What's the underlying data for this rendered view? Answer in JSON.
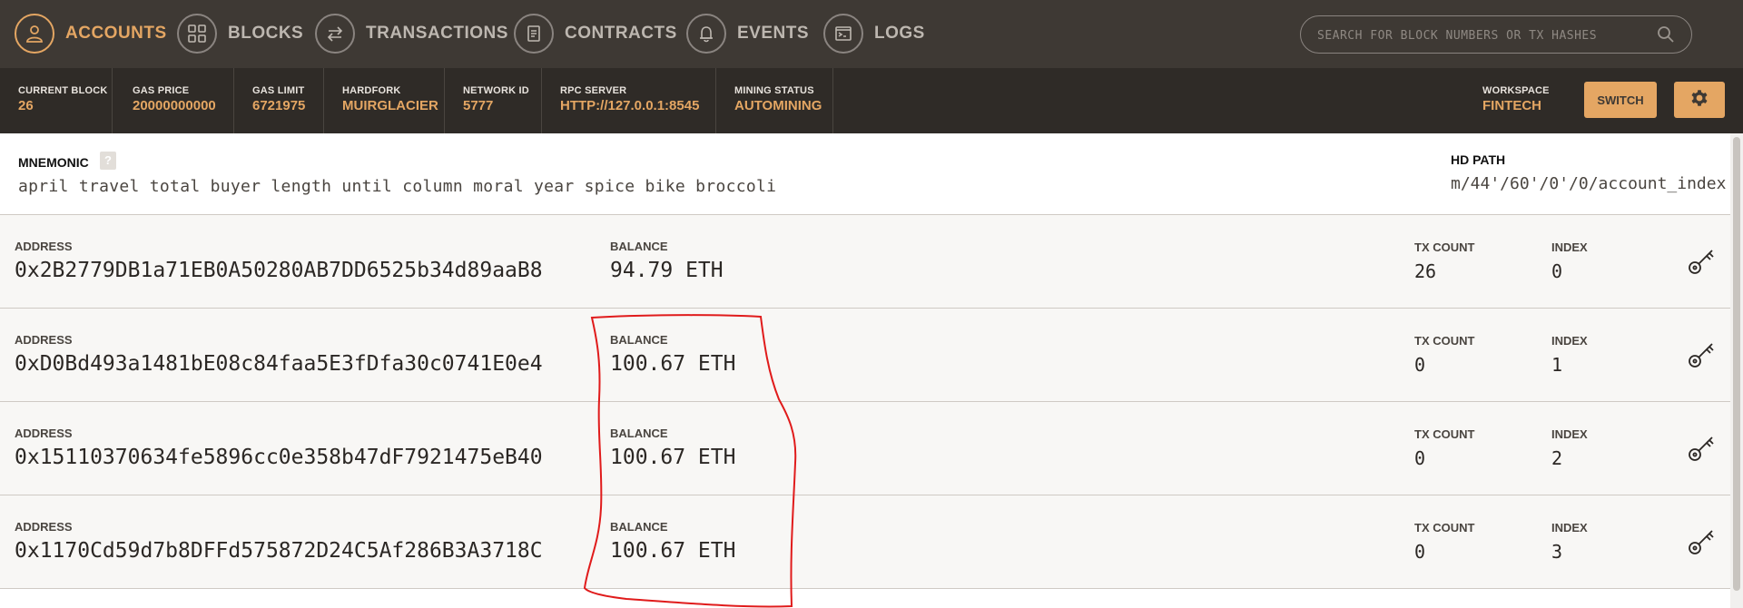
{
  "nav": {
    "items": [
      {
        "label": "ACCOUNTS",
        "icon": "user-icon",
        "active": true
      },
      {
        "label": "BLOCKS",
        "icon": "grid-icon",
        "active": false
      },
      {
        "label": "TRANSACTIONS",
        "icon": "transfer-icon",
        "active": false
      },
      {
        "label": "CONTRACTS",
        "icon": "document-icon",
        "active": false
      },
      {
        "label": "EVENTS",
        "icon": "bell-icon",
        "active": false
      },
      {
        "label": "LOGS",
        "icon": "terminal-icon",
        "active": false
      }
    ],
    "search_placeholder": "SEARCH FOR BLOCK NUMBERS OR TX HASHES"
  },
  "status": {
    "current_block": {
      "label": "CURRENT BLOCK",
      "value": "26"
    },
    "gas_price": {
      "label": "GAS PRICE",
      "value": "20000000000"
    },
    "gas_limit": {
      "label": "GAS LIMIT",
      "value": "6721975"
    },
    "hardfork": {
      "label": "HARDFORK",
      "value": "MUIRGLACIER"
    },
    "network_id": {
      "label": "NETWORK ID",
      "value": "5777"
    },
    "rpc_server": {
      "label": "RPC SERVER",
      "value": "HTTP://127.0.0.1:8545"
    },
    "mining_status": {
      "label": "MINING STATUS",
      "value": "AUTOMINING"
    },
    "workspace": {
      "label": "WORKSPACE",
      "value": "FINTECH"
    },
    "switch_label": "SWITCH"
  },
  "mnemonic": {
    "label": "MNEMONIC",
    "help": "?",
    "words": "april travel total buyer length until column moral year spice bike broccoli",
    "hd_path_label": "HD PATH",
    "hd_path": "m/44'/60'/0'/0/account_index"
  },
  "labels": {
    "address": "ADDRESS",
    "balance": "BALANCE",
    "tx_count": "TX COUNT",
    "index": "INDEX"
  },
  "accounts": [
    {
      "address": "0x2B2779DB1a71EB0A50280AB7DD6525b34d89aaB8",
      "balance": "94.79 ETH",
      "tx_count": "26",
      "index": "0"
    },
    {
      "address": "0xD0Bd493a1481bE08c84faa5E3fDfa30c0741E0e4",
      "balance": "100.67 ETH",
      "tx_count": "0",
      "index": "1"
    },
    {
      "address": "0x15110370634fe5896cc0e358b47dF7921475eB40",
      "balance": "100.67 ETH",
      "tx_count": "0",
      "index": "2"
    },
    {
      "address": "0x1170Cd59d7b8DFFd575872D24C5Af286B3A3718C",
      "balance": "100.67 ETH",
      "tx_count": "0",
      "index": "3"
    }
  ],
  "colors": {
    "accent": "#e4a663",
    "nav_bg": "#3e3934",
    "status_bg": "#2f2b27",
    "annotation": "#e01b1b"
  }
}
